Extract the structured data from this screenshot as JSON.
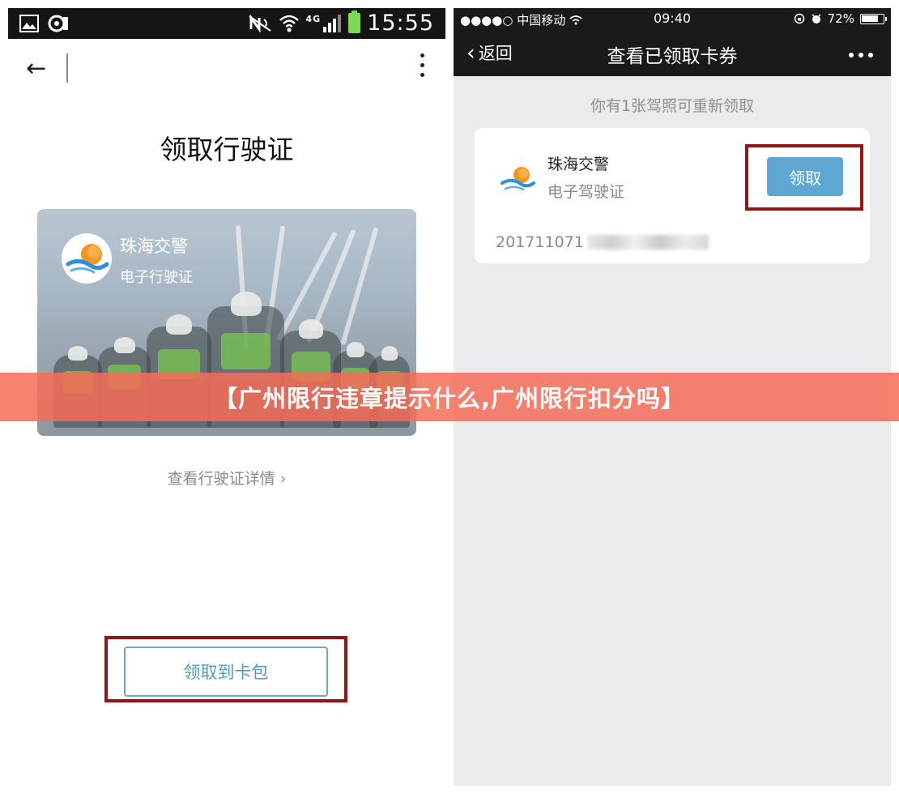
{
  "left_phone": {
    "status_bar": {
      "network": "4G",
      "time": "15:55"
    },
    "page_title": "领取行驶证",
    "card": {
      "org_name": "珠海交警",
      "card_type": "电子行驶证"
    },
    "detail_link": "查看行驶证详情 ›",
    "collect_button": "领取到卡包"
  },
  "right_phone": {
    "status_bar": {
      "carrier": "●●●●○ 中国移动",
      "time": "09:40",
      "battery": "72%"
    },
    "nav": {
      "back_label": "返回",
      "title": "查看已领取卡券"
    },
    "notice": "你有1张驾照可重新领取",
    "coupon": {
      "org_name": "珠海交警",
      "card_type": "电子驾驶证",
      "claim_button": "领取",
      "number_prefix": "201711071"
    }
  },
  "banner": {
    "text": "【广州限行违章提示什么,广州限行扣分吗】"
  },
  "colors": {
    "accent_blue": "#5ea7d2",
    "highlight_red": "#8e1616",
    "banner": "#f46e58",
    "logo_orange": "#f5961e"
  }
}
